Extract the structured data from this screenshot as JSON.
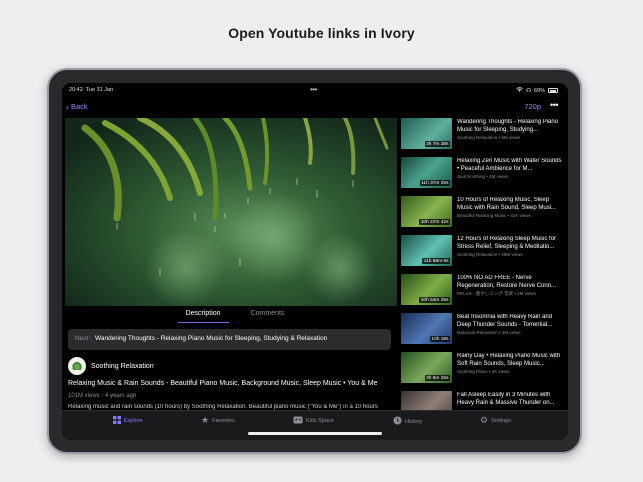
{
  "headline": "Open Youtube links in Ivory",
  "status_bar": {
    "time": "20:42",
    "date": "Tue 31 Jan",
    "battery": "69%"
  },
  "nav": {
    "back_label": "Back",
    "quality": "720p"
  },
  "tabs": [
    {
      "label": "Description",
      "active": true
    },
    {
      "label": "Comments",
      "active": false
    }
  ],
  "next": {
    "label": "Next:",
    "title": "Wandering Thoughts - Relaxing Piano Music for Sleeping, Studying & Relaxation"
  },
  "channel": {
    "name": "Soothing Relaxation"
  },
  "video": {
    "title": "Relaxing Music & Rain Sounds - Beautiful Piano Music, Background Music, Sleep Music • You & Me",
    "meta": "101M views  ·  4 years ago",
    "description": "Relaxing music and rain sounds (10 hours) by Soothing Relaxation. Beautiful piano music (\"You & Me\") in a 10 hours"
  },
  "related": [
    {
      "title": "Wandering Thoughts - Relaxing Piano Music for Sleeping, Studying...",
      "meta": "Soothing Relaxation • 5M views",
      "duration": "3h 7m 38s",
      "thumb_color": "#3f8d7f"
    },
    {
      "title": "Relaxing Zen Music with Water Sounds • Peaceful Ambience for M...",
      "meta": "Soul Soothing • 4M views",
      "duration": "11h 37m 25s",
      "thumb_color": "#2a7a6a"
    },
    {
      "title": "10 Hours of Relaxing Music, Sleep Music with Rain Sound, Sleep Musi...",
      "meta": "Beautiful Relaxing Music • 41K views",
      "duration": "10h 47m 42s",
      "thumb_color": "#4b7f2f"
    },
    {
      "title": "12 Hours of Relaxing Sleep Music for Stress Relief, Sleeping & Meditatio...",
      "meta": "Soothing Relaxation • 29M views",
      "duration": "11h 58m 9s",
      "thumb_color": "#2e8e7e"
    },
    {
      "title": "100% NO AD FREE - Nerve Regeneration, Restore Nerve Conn...",
      "meta": "RELAX - 癒やしソング 音楽 • 2M views",
      "duration": "10h 54m 25s",
      "thumb_color": "#3f7a28"
    },
    {
      "title": "Beat Insomnia with Heavy Rain and Deep Thunder Sounds - Torrential...",
      "meta": "Naturous Relaxation • 1M views",
      "duration": "10h 18s",
      "thumb_color": "#2e4f87"
    },
    {
      "title": "Rainy Day • Relaxing Piano Music with Soft Rain Sounds, Sleep Music...",
      "meta": "Soothing Piano • 4K views",
      "duration": "3h 5m 25s",
      "thumb_color": "#3e7d3d"
    },
    {
      "title": "Fall Asleep Easily in 3 Minutes with Heavy Rain & Massive Thunder on...",
      "meta": "",
      "duration": "",
      "thumb_color": "#6a5f5a"
    }
  ],
  "tabbar": [
    {
      "label": "Explore",
      "icon": "grid-icon",
      "active": true
    },
    {
      "label": "Favorites",
      "icon": "star-icon",
      "active": false
    },
    {
      "label": "Kids Space",
      "icon": "kids-icon",
      "active": false
    },
    {
      "label": "History",
      "icon": "clock-icon",
      "active": false
    },
    {
      "label": "Settings",
      "icon": "gear-icon",
      "active": false
    }
  ]
}
